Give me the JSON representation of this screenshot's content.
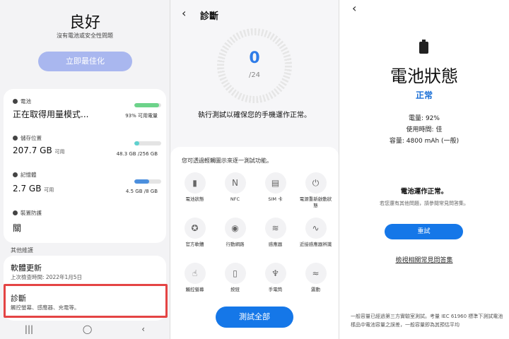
{
  "left": {
    "title": "良好",
    "subtitle": "沒有電池或安全性問題",
    "optimize_button": "立即最佳化",
    "battery": {
      "label": "電池",
      "value": "正在取得用量模式...",
      "right": "93% 可用電量",
      "fill_percent": 93,
      "color": "#6dd38a"
    },
    "storage": {
      "label": "儲存位置",
      "value": "207.7 GB",
      "value_unit": "可用",
      "right": "48.3 GB /256 GB",
      "fill_percent": 19,
      "color": "#5fd1cf"
    },
    "memory": {
      "label": "記憶體",
      "value": "2.7 GB",
      "value_unit": "可用",
      "right": "4.5 GB /8 GB",
      "fill_percent": 56,
      "color": "#4b8fde"
    },
    "protection": {
      "label": "裝置防護",
      "value": "關"
    },
    "section_label": "其他維護",
    "software_update": {
      "title": "軟體更新",
      "subtitle": "上次檢查時間: 2022年1月5日"
    },
    "diagnostics": {
      "title": "診斷",
      "subtitle": "觸控螢幕、感應器、充電等。"
    },
    "nav": [
      "|||",
      "◯",
      "‹"
    ]
  },
  "middle": {
    "back": "‹",
    "title": "診斷",
    "ring_number": "0",
    "ring_total": "/24",
    "description": "執行測試以確保您的手機運作正常。",
    "hint": "您可透過輕觸圖示來逐一測試功能。",
    "tests": [
      {
        "label": "電池狀態",
        "icon": "battery-icon",
        "glyph": "▮"
      },
      {
        "label": "NFC",
        "icon": "nfc-icon",
        "glyph": "N"
      },
      {
        "label": "SIM 卡",
        "icon": "sim-card-icon",
        "glyph": "▤"
      },
      {
        "label": "電源重新啟動狀態",
        "icon": "power-icon",
        "glyph": "⏻"
      },
      {
        "label": "官方軟體",
        "icon": "badge-icon",
        "glyph": "✪"
      },
      {
        "label": "行動網路",
        "icon": "antenna-icon",
        "glyph": "◉"
      },
      {
        "label": "感應器",
        "icon": "vibration-icon",
        "glyph": "≋"
      },
      {
        "label": "近接感應器辨識",
        "icon": "proximity-icon",
        "glyph": "∿"
      },
      {
        "label": "觸控螢幕",
        "icon": "touch-icon",
        "glyph": "☝"
      },
      {
        "label": "按鈕",
        "icon": "button-icon",
        "glyph": "▯"
      },
      {
        "label": "手電筒",
        "icon": "flashlight-icon",
        "glyph": "♆"
      },
      {
        "label": "震動",
        "icon": "vibrate-icon",
        "glyph": "≈"
      }
    ],
    "test_all_button": "測試全部"
  },
  "right": {
    "back": "‹",
    "title": "電池狀態",
    "status": "正常",
    "info": [
      "電量: 92%",
      "使用時間: 佳",
      "容量: 4800 mAh (一般)"
    ],
    "ok_title": "電池運作正常。",
    "ok_subtitle": "若您還有其他問題，請參閱常見問答集。",
    "retry_button": "重試",
    "faq_link": "檢視相關常見問答集",
    "footer": "一般容量已經過第三方實驗室測試。考量 IEC 61960 標準下測試電池樣品中電池容量之誤差，一般容量即為其預估平均"
  }
}
